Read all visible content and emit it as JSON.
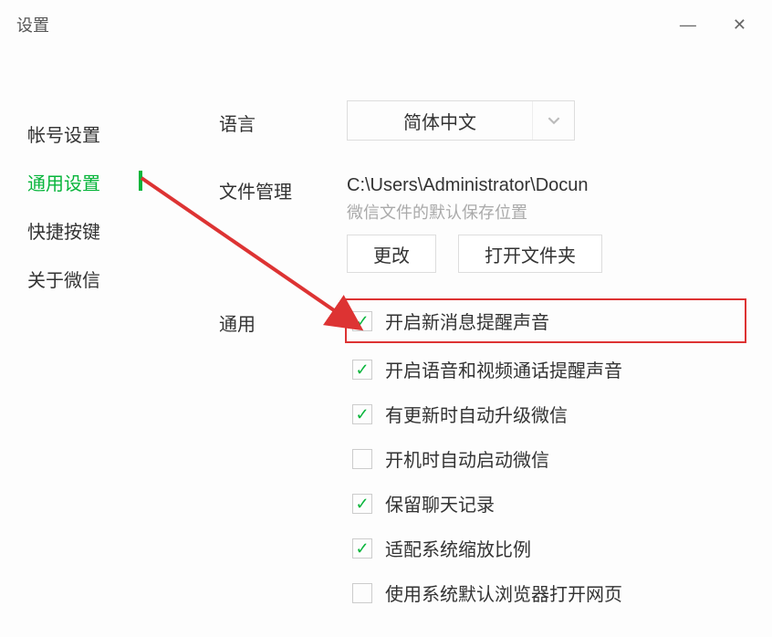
{
  "window": {
    "title": "设置"
  },
  "sidebar": {
    "items": [
      {
        "label": "帐号设置"
      },
      {
        "label": "通用设置"
      },
      {
        "label": "快捷按键"
      },
      {
        "label": "关于微信"
      }
    ],
    "active_index": 1
  },
  "language": {
    "label": "语言",
    "value": "简体中文"
  },
  "file_manage": {
    "label": "文件管理",
    "path": "C:\\Users\\Administrator\\Docun",
    "hint": "微信文件的默认保存位置",
    "change_btn": "更改",
    "open_btn": "打开文件夹"
  },
  "general": {
    "label": "通用",
    "options": [
      {
        "label": "开启新消息提醒声音",
        "checked": true,
        "highlight": true
      },
      {
        "label": "开启语音和视频通话提醒声音",
        "checked": true,
        "highlight": false
      },
      {
        "label": "有更新时自动升级微信",
        "checked": true,
        "highlight": false
      },
      {
        "label": "开机时自动启动微信",
        "checked": false,
        "highlight": false
      },
      {
        "label": "保留聊天记录",
        "checked": true,
        "highlight": false
      },
      {
        "label": "适配系统缩放比例",
        "checked": true,
        "highlight": false
      },
      {
        "label": "使用系统默认浏览器打开网页",
        "checked": false,
        "highlight": false
      }
    ]
  }
}
